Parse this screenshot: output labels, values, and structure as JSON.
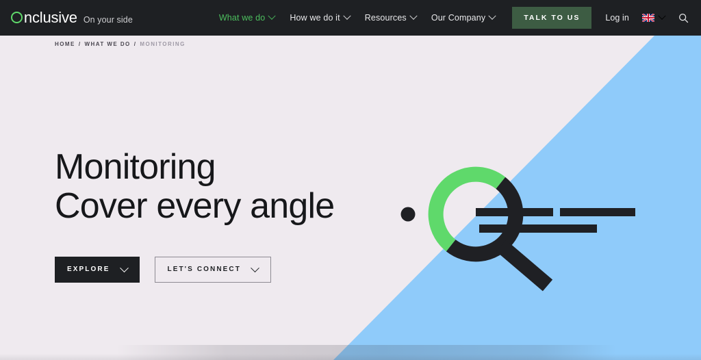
{
  "header": {
    "logo_text": "Onclusive",
    "logo_first_letter": "O",
    "logo_rest": "nclusive",
    "tagline": "On your side",
    "nav_items": [
      {
        "label": "What we do",
        "active": true,
        "icon": "chevron-down-icon"
      },
      {
        "label": "How we do it",
        "active": false,
        "icon": "chevron-down-icon"
      },
      {
        "label": "Resources",
        "active": false,
        "icon": "chevron-down-icon"
      },
      {
        "label": "Our Company",
        "active": false,
        "icon": "chevron-down-icon"
      }
    ],
    "cta_label": "TALK TO US",
    "login_label": "Log in",
    "language": {
      "flag": "uk-flag-icon",
      "icon": "chevron-down-icon"
    },
    "search_icon": "search-icon"
  },
  "breadcrumb": {
    "items": [
      {
        "label": "HOME",
        "current": false
      },
      {
        "label": "WHAT WE DO",
        "current": false
      },
      {
        "label": "MONITORING",
        "current": true
      }
    ],
    "separator": "/"
  },
  "hero": {
    "title": "Monitoring",
    "subtitle": "Cover every angle",
    "primary_button": {
      "label": "EXPLORE",
      "icon": "chevron-down-icon"
    },
    "secondary_button": {
      "label": "LET'S CONNECT",
      "icon": "chevron-down-icon"
    }
  },
  "illustration": {
    "name": "magnifying-glass-graphic",
    "dot": "dot-shape",
    "ring_green": "#5fd96b",
    "ring_dark": "#1f2024",
    "lines": 3
  },
  "colors": {
    "header_bg": "#1e2023",
    "page_bg": "#efeaef",
    "accent_blue": "#8fcbfa",
    "accent_green": "#5fd96b",
    "cta_green": "#3d5c43",
    "text_dark": "#16171a"
  }
}
